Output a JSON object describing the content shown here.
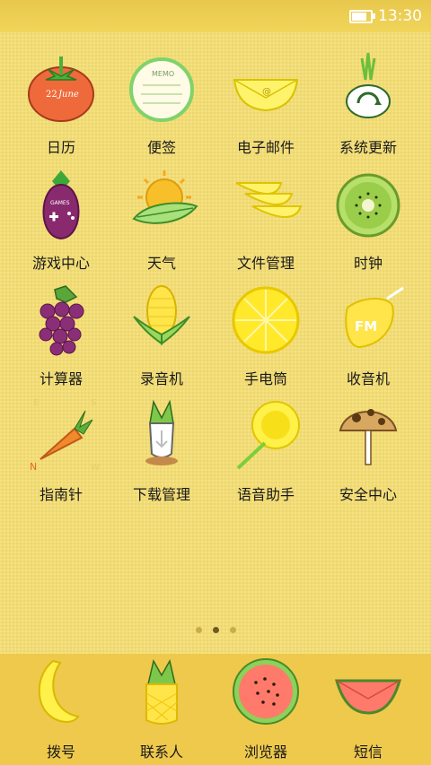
{
  "status": {
    "time": "13:30",
    "battery_level": 0.9
  },
  "apps": [
    {
      "label": "日历",
      "icon": "tomato-calendar-icon",
      "badge_day": "22",
      "badge_month": "June"
    },
    {
      "label": "便签",
      "icon": "notes-icon",
      "memo": "MEMO"
    },
    {
      "label": "电子邮件",
      "icon": "lemon-envelope-icon",
      "at": "@"
    },
    {
      "label": "系统更新",
      "icon": "onion-update-icon"
    },
    {
      "label": "游戏中心",
      "icon": "eggplant-game-icon",
      "games": "GAMES"
    },
    {
      "label": "天气",
      "icon": "sun-leaf-weather-icon"
    },
    {
      "label": "文件管理",
      "icon": "lemon-slices-files-icon"
    },
    {
      "label": "时钟",
      "icon": "kiwi-clock-icon"
    },
    {
      "label": "计算器",
      "icon": "grape-calculator-icon"
    },
    {
      "label": "录音机",
      "icon": "corn-recorder-icon"
    },
    {
      "label": "手电筒",
      "icon": "lemon-flashlight-icon"
    },
    {
      "label": "收音机",
      "icon": "lemon-radio-icon",
      "fm": "FM"
    },
    {
      "label": "指南针",
      "icon": "carrot-compass-icon",
      "n": "N",
      "e": "E",
      "s": "S",
      "w": "W"
    },
    {
      "label": "下载管理",
      "icon": "radish-download-icon"
    },
    {
      "label": "语音助手",
      "icon": "sunflower-voice-icon"
    },
    {
      "label": "安全中心",
      "icon": "mushroom-security-icon"
    }
  ],
  "dock": [
    {
      "label": "拨号",
      "icon": "banana-phone-icon"
    },
    {
      "label": "联系人",
      "icon": "pineapple-contacts-icon"
    },
    {
      "label": "浏览器",
      "icon": "watermelon-browser-icon"
    },
    {
      "label": "短信",
      "icon": "watermelon-envelope-sms-icon"
    }
  ],
  "pager": {
    "pages": 3,
    "current": 2
  }
}
